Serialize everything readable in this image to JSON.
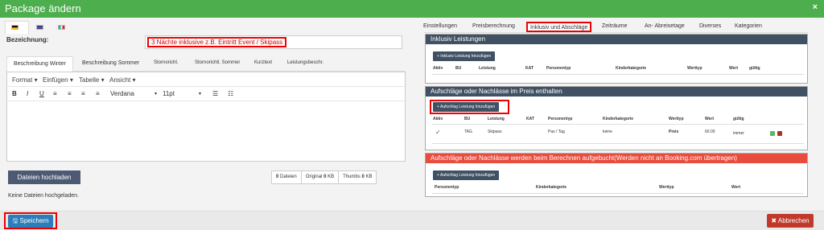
{
  "window": {
    "title": "Package ändern",
    "close_label": "×"
  },
  "languages": [
    "de",
    "en",
    "it"
  ],
  "form": {
    "bezeichnung_label": "Bezeichnung:",
    "bezeichnung_value": "3 Nächte inklusive z.B. Eintritt Event / Skipass"
  },
  "left_tabs": [
    "Beschreibung Winter",
    "Beschreibung Sommer",
    "Stornoricht.",
    "Stornorichtl. Sommer",
    "Kurztext",
    "Leistungsbeschr."
  ],
  "editor": {
    "menu": [
      "Format",
      "Einfügen",
      "Tabelle",
      "Ansicht"
    ],
    "font": "Verdana",
    "size": "11pt"
  },
  "files": {
    "upload_label": "Dateien hochladen",
    "count": "0",
    "count_label": "Dateien",
    "original": "0",
    "original_label": "Original",
    "original_unit": "KB",
    "thumbs": "0",
    "thumbs_label": "Thumbs",
    "thumbs_unit": "KB",
    "empty_text": "Keine Dateien hochgeladen."
  },
  "footer": {
    "save_label": "Speichern",
    "cancel_label": "Abbrechen"
  },
  "right_tabs": [
    "Einstellungen",
    "Preisberechnung",
    "Inklusiv und Abschläge",
    "Zeiträume",
    "An- Abreisetage",
    "Diverses",
    "Kategorien"
  ],
  "panel1": {
    "title": "Inklusiv Leistungen",
    "button": "+ Inklusiv Leistung hinzufügen",
    "headers": [
      "Aktiv",
      "BU",
      "Leistung",
      "KAT",
      "Personentyp",
      "Kinderkategorie",
      "Werttyp",
      "Wert",
      "gültig"
    ]
  },
  "panel2": {
    "title": "Aufschläge oder Nachlässe im Preis enthalten",
    "button": "+ Aufschlag Leistung hinzufügen",
    "headers": [
      "Aktiv",
      "BU",
      "Leistung",
      "KAT",
      "Personentyp",
      "Kinderkategorie",
      "Werttyp",
      "Wert",
      "gültig"
    ],
    "row": {
      "aktiv": "✓",
      "bu": "TAG",
      "leistung": "Skipass",
      "kat": "",
      "personentyp": "Pax / Tag",
      "kinderkategorie": "keine",
      "werttyp": "Preis",
      "wert": "60.00",
      "gueltig": "immer"
    }
  },
  "panel3": {
    "title": "Aufschläge oder Nachlässe werden beim Berechnen aufgebucht(Werden nicht an Booking.com übertragen)",
    "button": "+ Aufschlag Leistung hinzufügen",
    "headers": [
      "Personentyp",
      "Kinderkategorie",
      "Werttyp",
      "Wert"
    ]
  },
  "colors": {
    "title_green": "#4cae4c",
    "panel_dark": "#3f5163",
    "panel_red": "#e74c3c",
    "save_blue": "#2b7dbb",
    "cancel_red": "#c0392b"
  }
}
